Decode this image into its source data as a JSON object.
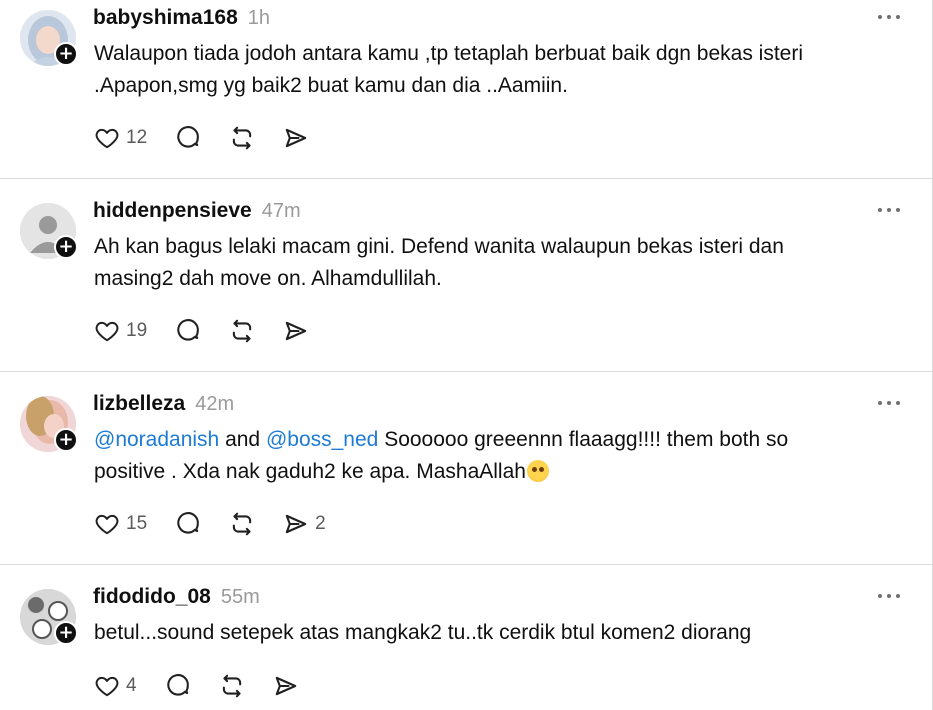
{
  "posts": [
    {
      "username": "babyshima168",
      "time": "1h",
      "text_parts": [
        "Walaupon tiada jodoh antara kamu ,tp tetaplah berbuat baik dgn bekas isteri",
        ".Apapon,smg yg baik2 buat kamu dan dia ..Aamiin."
      ],
      "likes": "12",
      "shares": "",
      "avatar": "woman-hijab-avatar"
    },
    {
      "username": "hiddenpensieve",
      "time": "47m",
      "text_parts": [
        "Ah kan bagus lelaki macam gini. Defend wanita walaupun bekas isteri dan",
        "masing2 dah move on. Alhamdullilah."
      ],
      "likes": "19",
      "shares": "",
      "avatar": "default-user-avatar"
    },
    {
      "username": "lizbelleza",
      "time": "42m",
      "mention1": "@noradanish",
      "and_text": " and ",
      "mention2": "@boss_ned",
      "line1_rest": " Soooooo greeennn flaaagg!!!! them both so",
      "line2": "positive . Xda nak gaduh2 ke apa. MashaAllah",
      "emoji": "pleading-face-emoji",
      "likes": "15",
      "shares": "2",
      "avatar": "woman-pink-avatar"
    },
    {
      "username": "fidodido_08",
      "time": "55m",
      "text": "betul...sound setepek atas mangkak2 tu..tk cerdik btul komen2 diorang",
      "likes": "4",
      "shares": "",
      "avatar": "pattern-avatar"
    }
  ],
  "icons": {
    "like": "heart-icon",
    "reply": "comment-icon",
    "repost": "repost-icon",
    "share": "send-icon",
    "more": "more-horizontal-icon",
    "follow": "plus-icon"
  },
  "colors": {
    "mention": "#1d7bd6",
    "time": "#9a9a9a",
    "divider": "#dcdcdc"
  }
}
